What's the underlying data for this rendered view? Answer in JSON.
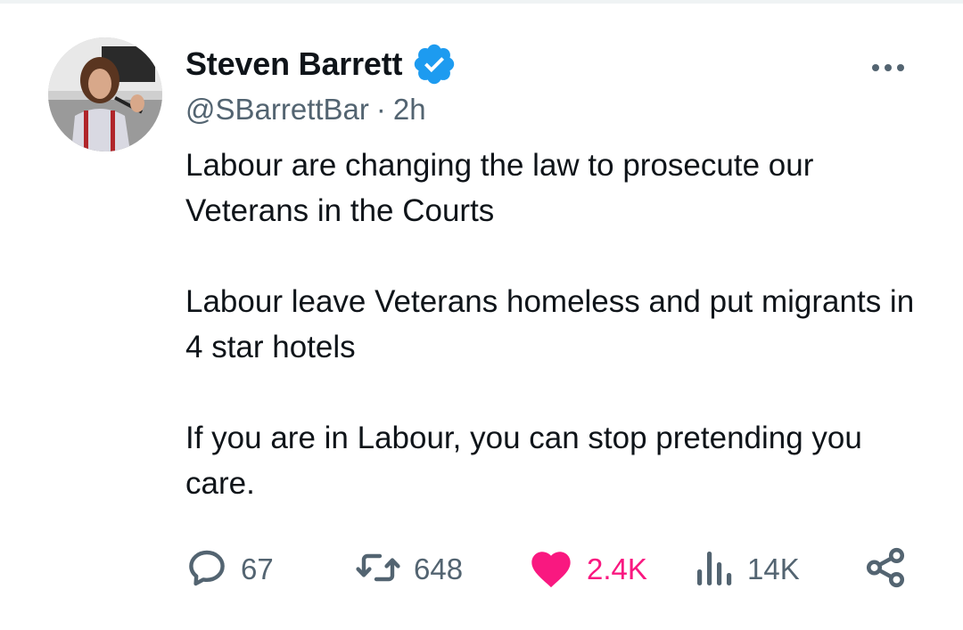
{
  "tweet": {
    "author": {
      "display_name": "Steven Barrett",
      "handle": "@SBarrettBar",
      "verified": true
    },
    "timestamp": "2h",
    "separator": "·",
    "paragraphs": [
      "Labour are changing the law to prosecute our Veterans in the Courts",
      "Labour leave Veterans homeless and put migrants in 4 star hotels",
      "If you are in Labour, you can stop pretending you care."
    ],
    "actions": {
      "reply": {
        "icon": "reply-icon",
        "count": "67"
      },
      "repost": {
        "icon": "repost-icon",
        "count": "648"
      },
      "like": {
        "icon": "heart-icon",
        "count": "2.4K",
        "liked": true
      },
      "views": {
        "icon": "views-icon",
        "count": "14K"
      },
      "share": {
        "icon": "share-icon"
      }
    }
  },
  "colors": {
    "text_primary": "#0f1419",
    "text_secondary": "#536471",
    "verified_blue": "#1d9bf0",
    "like_pink": "#f91880"
  }
}
